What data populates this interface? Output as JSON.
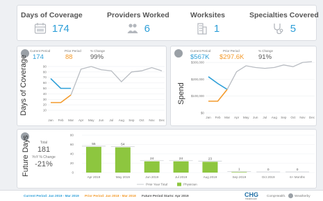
{
  "kpis": [
    {
      "title": "Days of Coverage",
      "value": "174",
      "icon": "calendar-icon"
    },
    {
      "title": "Providers Worked",
      "value": "6",
      "icon": "people-icon"
    },
    {
      "title": "Worksites",
      "value": "1",
      "icon": "building-icon"
    },
    {
      "title": "Specialties Covered",
      "value": "5",
      "icon": "stethoscope-icon"
    }
  ],
  "colors": {
    "accent": "#2e9fd8",
    "prior": "#f39a2b",
    "trend": "#b8bcc2",
    "bar": "#8dc63f",
    "subtitle_green": "#7ab648"
  },
  "coverage_panel": {
    "ylabel": "Days of Coverage",
    "current_label": "Current Period",
    "current_value": "174",
    "prior_label": "Prior Period",
    "prior_value": "88",
    "change_label": "% Change",
    "change_value": "99%"
  },
  "spend_panel": {
    "ylabel": "Spend",
    "current_label": "Current Period",
    "current_value": "$567K",
    "prior_label": "Prior Period",
    "prior_value": "$297.6K",
    "change_label": "% Change",
    "change_value": "91%"
  },
  "future_panel": {
    "ylabel": "Future Days",
    "total_label": "Total",
    "total_value": "181",
    "yoy_label": "YoY % Change",
    "yoy_value": "-21%",
    "legend_prior": "Prior Year Total",
    "legend_physician": "Physician"
  },
  "footer": {
    "current": "Current Period: Jan 2019 - Mar 2019",
    "prior": "Prior Period: Jan 2018 - Mar 2018",
    "future": "Future Period Starts: Apr 2019",
    "brand": "CHG",
    "brand_sub": "Healthcare",
    "partner1": "CompHealth.",
    "partner2": "Weatherby"
  },
  "chart_data": [
    {
      "type": "line",
      "ylabel": "Days of Coverage",
      "categories": [
        "Jan",
        "Feb",
        "Mar",
        "Apr",
        "May",
        "Jun",
        "Jul",
        "Aug",
        "Sep",
        "Oct",
        "Nov",
        "Dec"
      ],
      "ylim": [
        0,
        100
      ],
      "yticks": [
        "10",
        "20",
        "30",
        "40",
        "50",
        "60",
        "70",
        "80",
        "90"
      ],
      "series": [
        {
          "values": [
            68,
            50,
            50,
            null,
            null,
            null,
            null,
            null,
            null,
            null,
            null,
            null
          ],
          "color": "#2e9fd8"
        },
        {
          "values": [
            24,
            24,
            38,
            null,
            null,
            null,
            null,
            null,
            null,
            null,
            null,
            null
          ],
          "color": "#f39a2b"
        },
        {
          "values": [
            null,
            null,
            38,
            85,
            90,
            84,
            82,
            62,
            80,
            82,
            88,
            82
          ],
          "color": "#b8bcc2"
        }
      ]
    },
    {
      "type": "line",
      "ylabel": "Spend",
      "categories": [
        "Jan",
        "Feb",
        "Mar",
        "Apr",
        "May",
        "Jun",
        "Jul",
        "Aug",
        "Sep",
        "Oct",
        "Nov",
        "Dec"
      ],
      "ylim": [
        0,
        325000
      ],
      "yticks": [
        "$0",
        "$100,000",
        "$200,000",
        "$300,000"
      ],
      "series": [
        {
          "values": [
            215000,
            175000,
            140000,
            null,
            null,
            null,
            null,
            null,
            null,
            null,
            null,
            null
          ],
          "color": "#2e9fd8"
        },
        {
          "values": [
            70000,
            70000,
            140000,
            null,
            null,
            null,
            null,
            null,
            null,
            null,
            null,
            null
          ],
          "color": "#f39a2b"
        },
        {
          "values": [
            null,
            null,
            140000,
            245000,
            280000,
            270000,
            265000,
            270000,
            285000,
            275000,
            300000,
            305000
          ],
          "color": "#b8bcc2"
        }
      ]
    },
    {
      "type": "bar",
      "categories": [
        "Apr 2019",
        "May 2019",
        "Jun 2019",
        "Jul 2019",
        "Aug 2019",
        "Sep 2019",
        "Oct 2019",
        "6+ Months"
      ],
      "ylim": [
        0,
        80
      ],
      "yticks": [
        "0",
        "20",
        "40",
        "60",
        "80"
      ],
      "series": [
        {
          "name": "Physician",
          "values": [
            55,
            54,
            24,
            24,
            23,
            1,
            0,
            0
          ]
        }
      ],
      "data_labels": [
        "55",
        "54",
        "24",
        "24",
        "23",
        "1",
        "0",
        "0"
      ],
      "legend": [
        "Prior Year Total",
        "Physician"
      ]
    }
  ]
}
